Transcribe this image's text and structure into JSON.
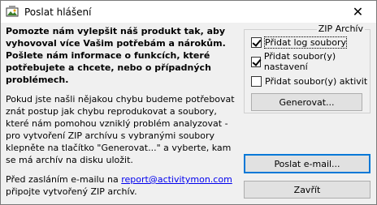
{
  "window": {
    "title": "Poslat hlášení",
    "app_icon": "app-icon",
    "close_glyph": "✕"
  },
  "content": {
    "intro": "Pomozte nám vylepšit náš produkt tak, aby vyhovoval více Vašim potřebám a nárokům. Pošlete nám informace o funkcích, které potřebujete a chcete, nebo o případných problémech.",
    "para1": "Pokud jste našli nějakou chybu budeme potřebovat znát postup jak chybu reprodukovat a soubory, které nám pomohou vzniklý problém analyzovat - pro vytvoření ZIP archívu s vybranými soubory klepněte na tlačítko \"Generovat...\" a vyberte, kam se má archív na disku uložit.",
    "para2_before": "Před zasláním e-mailu na ",
    "email": "report@activitymon.com",
    "para2_after": " připojte vytvořený ZIP archív."
  },
  "zip_group": {
    "title": "ZIP Archív",
    "checkboxes": [
      {
        "label": "Přidat log soubory",
        "checked": true
      },
      {
        "label": "Přidat soubor(y) nastavení",
        "checked": true
      },
      {
        "label": "Přidat soubor(y) aktivit",
        "checked": false
      }
    ],
    "generate_label": "Generovat..."
  },
  "buttons": {
    "send_email_label": "Poslat e-mail...",
    "close_label": "Zavřít"
  },
  "colors": {
    "link": "#0000ee",
    "default_button_border": "#0078d7"
  }
}
